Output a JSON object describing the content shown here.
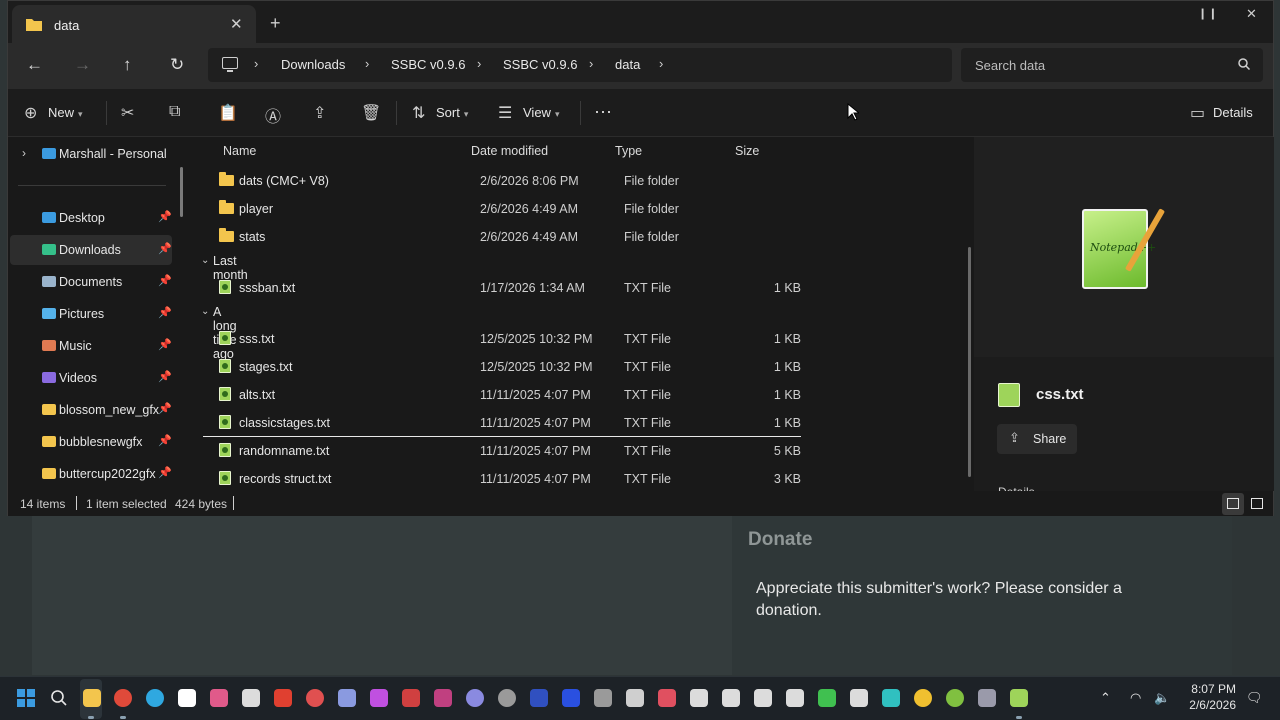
{
  "window": {
    "tab_title": "data",
    "tab_close": "✕",
    "tab_new": "+",
    "minimize": "❙❙",
    "close": "✕"
  },
  "nav": {
    "back": "←",
    "forward": "→",
    "up": "↑",
    "refresh": "↻",
    "breadcrumbs": [
      "Downloads",
      "SSBC v0.9.6",
      "SSBC v0.9.6",
      "data"
    ],
    "sep": "›",
    "search_placeholder": "Search data"
  },
  "toolbar": {
    "new": "New",
    "sort": "Sort",
    "view": "View",
    "more": "···",
    "details": "Details"
  },
  "sidebar": {
    "top": "Marshall - Personal",
    "items": [
      {
        "label": "Desktop",
        "color": "#3b9be0"
      },
      {
        "label": "Downloads",
        "color": "#35c08a"
      },
      {
        "label": "Documents",
        "color": "#9ab4cc"
      },
      {
        "label": "Pictures",
        "color": "#55b2ea"
      },
      {
        "label": "Music",
        "color": "#e07a52"
      },
      {
        "label": "Videos",
        "color": "#8a6ae0"
      },
      {
        "label": "blossom_new_gfx",
        "color": "#f3c54d"
      },
      {
        "label": "bubblesnewgfx",
        "color": "#f3c54d"
      },
      {
        "label": "buttercup2022gfx",
        "color": "#f3c54d"
      }
    ],
    "pin": "📌"
  },
  "columns": {
    "name": "Name",
    "date": "Date modified",
    "type": "Type",
    "size": "Size"
  },
  "rows": [
    {
      "name": "dats (CMC+ V8)",
      "date": "2/6/2026 8:06 PM",
      "type": "File folder",
      "size": "",
      "kind": "folder"
    },
    {
      "name": "player",
      "date": "2/6/2026 4:49 AM",
      "type": "File folder",
      "size": "",
      "kind": "folder"
    },
    {
      "name": "stats",
      "date": "2/6/2026 4:49 AM",
      "type": "File folder",
      "size": "",
      "kind": "folder"
    }
  ],
  "group_last_month": {
    "label": "Last month",
    "rows": [
      {
        "name": "sssban.txt",
        "date": "1/17/2026 1:34 AM",
        "type": "TXT File",
        "size": "1 KB"
      }
    ]
  },
  "group_long_ago": {
    "label": "A long time ago",
    "rows": [
      {
        "name": "sss.txt",
        "date": "12/5/2025 10:32 PM",
        "type": "TXT File",
        "size": "1 KB"
      },
      {
        "name": "stages.txt",
        "date": "12/5/2025 10:32 PM",
        "type": "TXT File",
        "size": "1 KB"
      },
      {
        "name": "alts.txt",
        "date": "11/11/2025 4:07 PM",
        "type": "TXT File",
        "size": "1 KB"
      },
      {
        "name": "classicstages.txt",
        "date": "11/11/2025 4:07 PM",
        "type": "TXT File",
        "size": "1 KB"
      },
      {
        "name": "randomname.txt",
        "date": "11/11/2025 4:07 PM",
        "type": "TXT File",
        "size": "5 KB"
      },
      {
        "name": "records struct.txt",
        "date": "11/11/2025 4:07 PM",
        "type": "TXT File",
        "size": "3 KB"
      }
    ]
  },
  "details": {
    "preview_label": "Notepad++",
    "file_name": "css.txt",
    "share": "Share",
    "more": "Details"
  },
  "status": {
    "items": "14 items",
    "selected": "1 item selected",
    "bytes": "424 bytes"
  },
  "background": {
    "donate_title": "Donate",
    "donate_text": "Appreciate this submitter's work? Please consider a donation."
  },
  "taskbar": {
    "time": "8:07 PM",
    "date": "2/6/2026",
    "icon_colors": [
      "#3b9be0",
      "#dcdcdc",
      "#f3c54d",
      "#e04a3a",
      "#2fa8e0",
      "#ffffff",
      "#e05a8a",
      "#dcdcdc",
      "#e04030",
      "#e05050",
      "#8a9ae0",
      "#c050e0",
      "#d04040",
      "#c04080",
      "#8a8ae0",
      "#9a9a9a",
      "#3050c0",
      "#2a50e0",
      "#9a9a9a",
      "#cfcfcf",
      "#e05060",
      "#dcdcdc",
      "#dcdcdc",
      "#dcdcdc",
      "#dcdcdc",
      "#40c050",
      "#dcdcdc",
      "#30c0c0",
      "#f0c030",
      "#80c040",
      "#9a9aaa",
      "#9ed45a"
    ]
  }
}
